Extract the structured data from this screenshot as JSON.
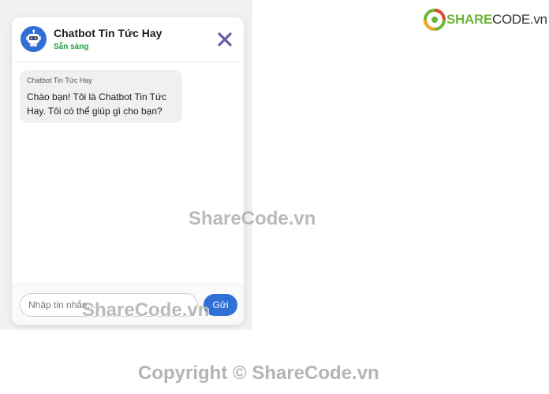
{
  "chat": {
    "title": "Chatbot Tin Tức Hay",
    "status": "Sẵn sàng",
    "status_color": "#23a046",
    "accent_color": "#2f6fd6",
    "close_icon_color": "#6a5aa8",
    "messages": [
      {
        "sender": "Chatbot Tin Tức Hay",
        "text": "Chào bạn! Tôi là Chatbot Tin Tức Hay. Tôi có thể giúp gì cho bạn?"
      }
    ],
    "input": {
      "value": "",
      "placeholder": "Nhập tin nhắn..."
    },
    "send_label": "Gửi"
  },
  "branding": {
    "logo_part1": "SHARE",
    "logo_part2": "CODE.vn",
    "watermark": "ShareCode.vn",
    "copyright": "Copyright © ShareCode.vn"
  }
}
